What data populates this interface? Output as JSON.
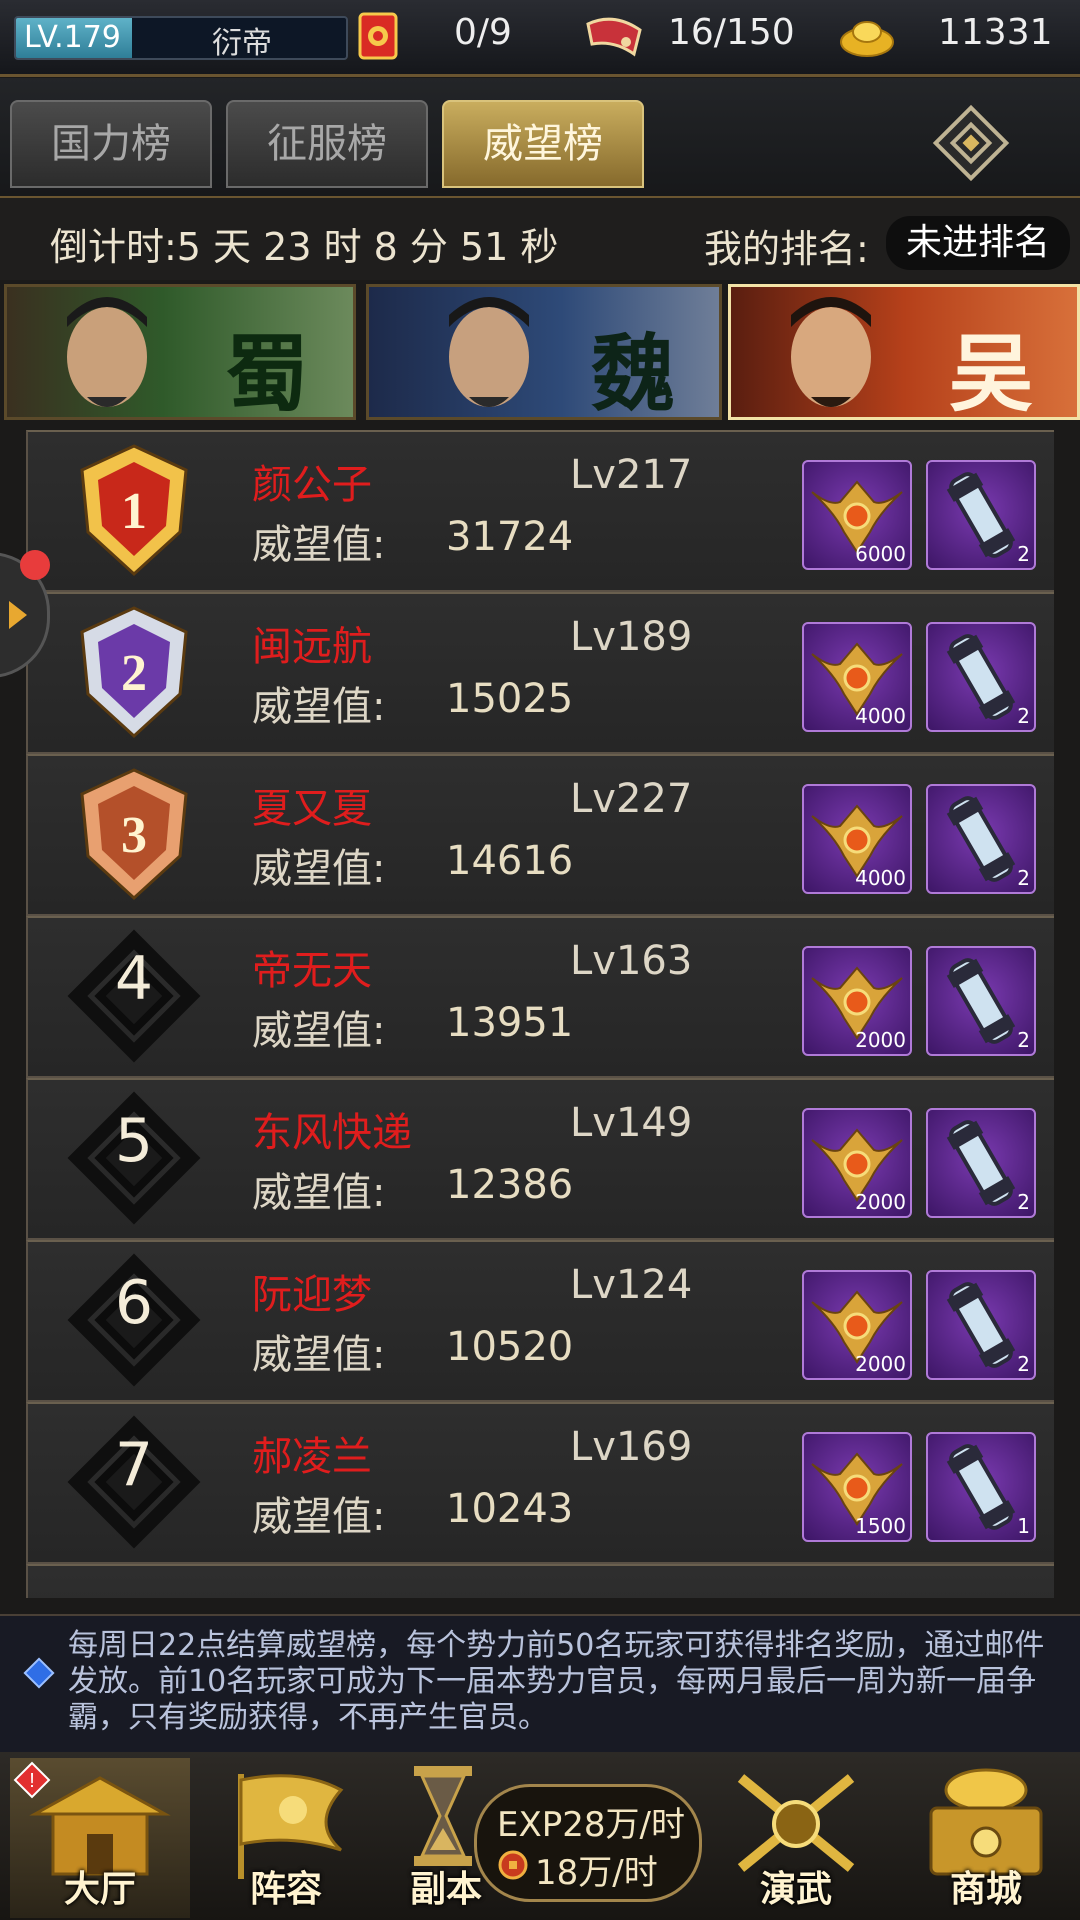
{
  "topbar": {
    "level": "LV.179",
    "level_progress": 0.35,
    "title": "衍帝",
    "tokens": "0/9",
    "stamina": "16/150",
    "gold": "11331"
  },
  "tabs": [
    {
      "label": "国力榜",
      "active": false
    },
    {
      "label": "征服榜",
      "active": false
    },
    {
      "label": "威望榜",
      "active": true
    }
  ],
  "countdown": {
    "label": "倒计时:5 天 23 时 8 分 51 秒",
    "my_rank_label": "我的排名:",
    "my_rank_value": "未进排名"
  },
  "factions": [
    {
      "name": "蜀",
      "active": false
    },
    {
      "name": "魏",
      "active": false
    },
    {
      "name": "吴",
      "active": true
    }
  ],
  "prestige_label": "威望值:",
  "rows": [
    {
      "rank": "1",
      "name": "颜公子",
      "level": "Lv217",
      "prestige": "31724",
      "reward1": "6000",
      "reward2": "2"
    },
    {
      "rank": "2",
      "name": "闽远航",
      "level": "Lv189",
      "prestige": "15025",
      "reward1": "4000",
      "reward2": "2"
    },
    {
      "rank": "3",
      "name": "夏又夏",
      "level": "Lv227",
      "prestige": "14616",
      "reward1": "4000",
      "reward2": "2"
    },
    {
      "rank": "4",
      "name": "帝无天",
      "level": "Lv163",
      "prestige": "13951",
      "reward1": "2000",
      "reward2": "2"
    },
    {
      "rank": "5",
      "name": "东风快递",
      "level": "Lv149",
      "prestige": "12386",
      "reward1": "2000",
      "reward2": "2"
    },
    {
      "rank": "6",
      "name": "阮迎梦",
      "level": "Lv124",
      "prestige": "10520",
      "reward1": "2000",
      "reward2": "2"
    },
    {
      "rank": "7",
      "name": "郝凌兰",
      "level": "Lv169",
      "prestige": "10243",
      "reward1": "1500",
      "reward2": "1"
    }
  ],
  "notice": "每周日22点结算威望榜，每个势力前50名玩家可获得排名奖励，通过邮件发放。前10名玩家可成为下一届本势力官员，每两月最后一周为新一届争霸，只有奖励获得，不再产生官员。",
  "nav": {
    "hall": "大厅",
    "lineup": "阵容",
    "dungeon": "副本",
    "rate_exp": "EXP28万/时",
    "rate_coin": "18万/时",
    "arena": "演武",
    "shop": "商城"
  },
  "colors": {
    "accent_gold": "#c9ad5e",
    "player_name": "#e01d1d",
    "item_border": "#b07ad8"
  }
}
